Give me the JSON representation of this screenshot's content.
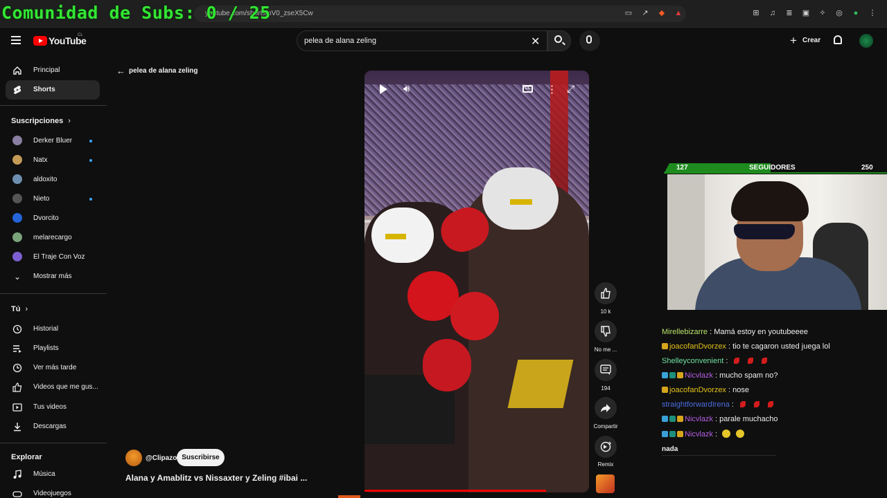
{
  "browser": {
    "url": "youtube.com/shorts/nV0_zseX5Cw"
  },
  "overlay": {
    "subs_goal": "Comunidad de Subs: 0 / 25",
    "followers_current": "127",
    "followers_label": "SEGUIDORES",
    "followers_goal": "250"
  },
  "header": {
    "logo_text": "YouTube",
    "region": "CL",
    "search_value": "pelea de alana zeling",
    "create_label": "Crear"
  },
  "sidebar": {
    "main": [
      {
        "label": "Principal",
        "icon": "home-icon"
      },
      {
        "label": "Shorts",
        "icon": "shorts-icon",
        "active": true
      }
    ],
    "subscriptions_title": "Suscripciones",
    "subscriptions": [
      {
        "label": "Derker Bluer",
        "new": true,
        "color": "#8a7fa3"
      },
      {
        "label": "Natx",
        "new": true,
        "color": "#c49a57"
      },
      {
        "label": "aldoxito",
        "new": false,
        "color": "#6e8fb0"
      },
      {
        "label": "Nieto",
        "new": true,
        "color": "#555555"
      },
      {
        "label": "Dvorcito",
        "new": false,
        "color": "#2563d8"
      },
      {
        "label": "melarecargo",
        "new": false,
        "color": "#7aa37a"
      },
      {
        "label": "El Traje Con Voz",
        "new": false,
        "color": "#7b5fd0"
      }
    ],
    "show_more": "Mostrar más",
    "you_title": "Tú",
    "you": [
      {
        "label": "Historial",
        "icon": "history-icon"
      },
      {
        "label": "Playlists",
        "icon": "playlists-icon"
      },
      {
        "label": "Ver más tarde",
        "icon": "watch-later-icon"
      },
      {
        "label": "Videos que me gus...",
        "icon": "liked-icon"
      },
      {
        "label": "Tus videos",
        "icon": "your-videos-icon"
      },
      {
        "label": "Descargas",
        "icon": "download-icon"
      }
    ],
    "explore_title": "Explorar",
    "explore": [
      {
        "label": "Música",
        "icon": "music-icon"
      },
      {
        "label": "Videojuegos",
        "icon": "gaming-icon"
      }
    ]
  },
  "main": {
    "back_label": "pelea de alana zeling",
    "channel": "@Clipazo",
    "subscribe_label": "Suscribirse",
    "title": "Alana y Amablitz vs Nissaxter y Zeling #ibai ...",
    "progress": 0.81
  },
  "actions": [
    {
      "icon": "like-icon",
      "label": "10 k"
    },
    {
      "icon": "dislike-icon",
      "label": "No me ..."
    },
    {
      "icon": "comments-icon",
      "label": "194"
    },
    {
      "icon": "share-icon",
      "label": "Compartir"
    },
    {
      "icon": "remix-icon",
      "label": "Remix"
    }
  ],
  "chat": [
    {
      "user": "Mirellebizarre",
      "color": "#b7e36a",
      "text": "Mamá estoy en youtubeeee",
      "badges": []
    },
    {
      "user": "joacofanDvorzex",
      "color": "#e6c21a",
      "text": "tio te cagaron usted juega lol",
      "badges": [
        "gold"
      ]
    },
    {
      "user": "Shelleyconvenient",
      "color": "#6fe0a0",
      "text": "",
      "emotes": "red",
      "badges": []
    },
    {
      "user": "Nicvlazk",
      "color": "#b35ee0",
      "text": "mucho spam no?",
      "badges": [
        "blue",
        "teal",
        "gold"
      ]
    },
    {
      "user": "joacofanDvorzex",
      "color": "#e6c21a",
      "text": "nose",
      "badges": [
        "gold"
      ]
    },
    {
      "user": "straightforwardIrena",
      "color": "#4a6de0",
      "text": "",
      "emotes": "red",
      "badges": []
    },
    {
      "user": "Nicvlazk",
      "color": "#b35ee0",
      "text": "parale muchacho",
      "badges": [
        "blue",
        "teal",
        "gold"
      ]
    },
    {
      "user": "Nicvlazk",
      "color": "#b35ee0",
      "text": "",
      "emotes": "face",
      "badges": [
        "blue",
        "teal",
        "gold"
      ]
    }
  ],
  "chat_last": "nada"
}
